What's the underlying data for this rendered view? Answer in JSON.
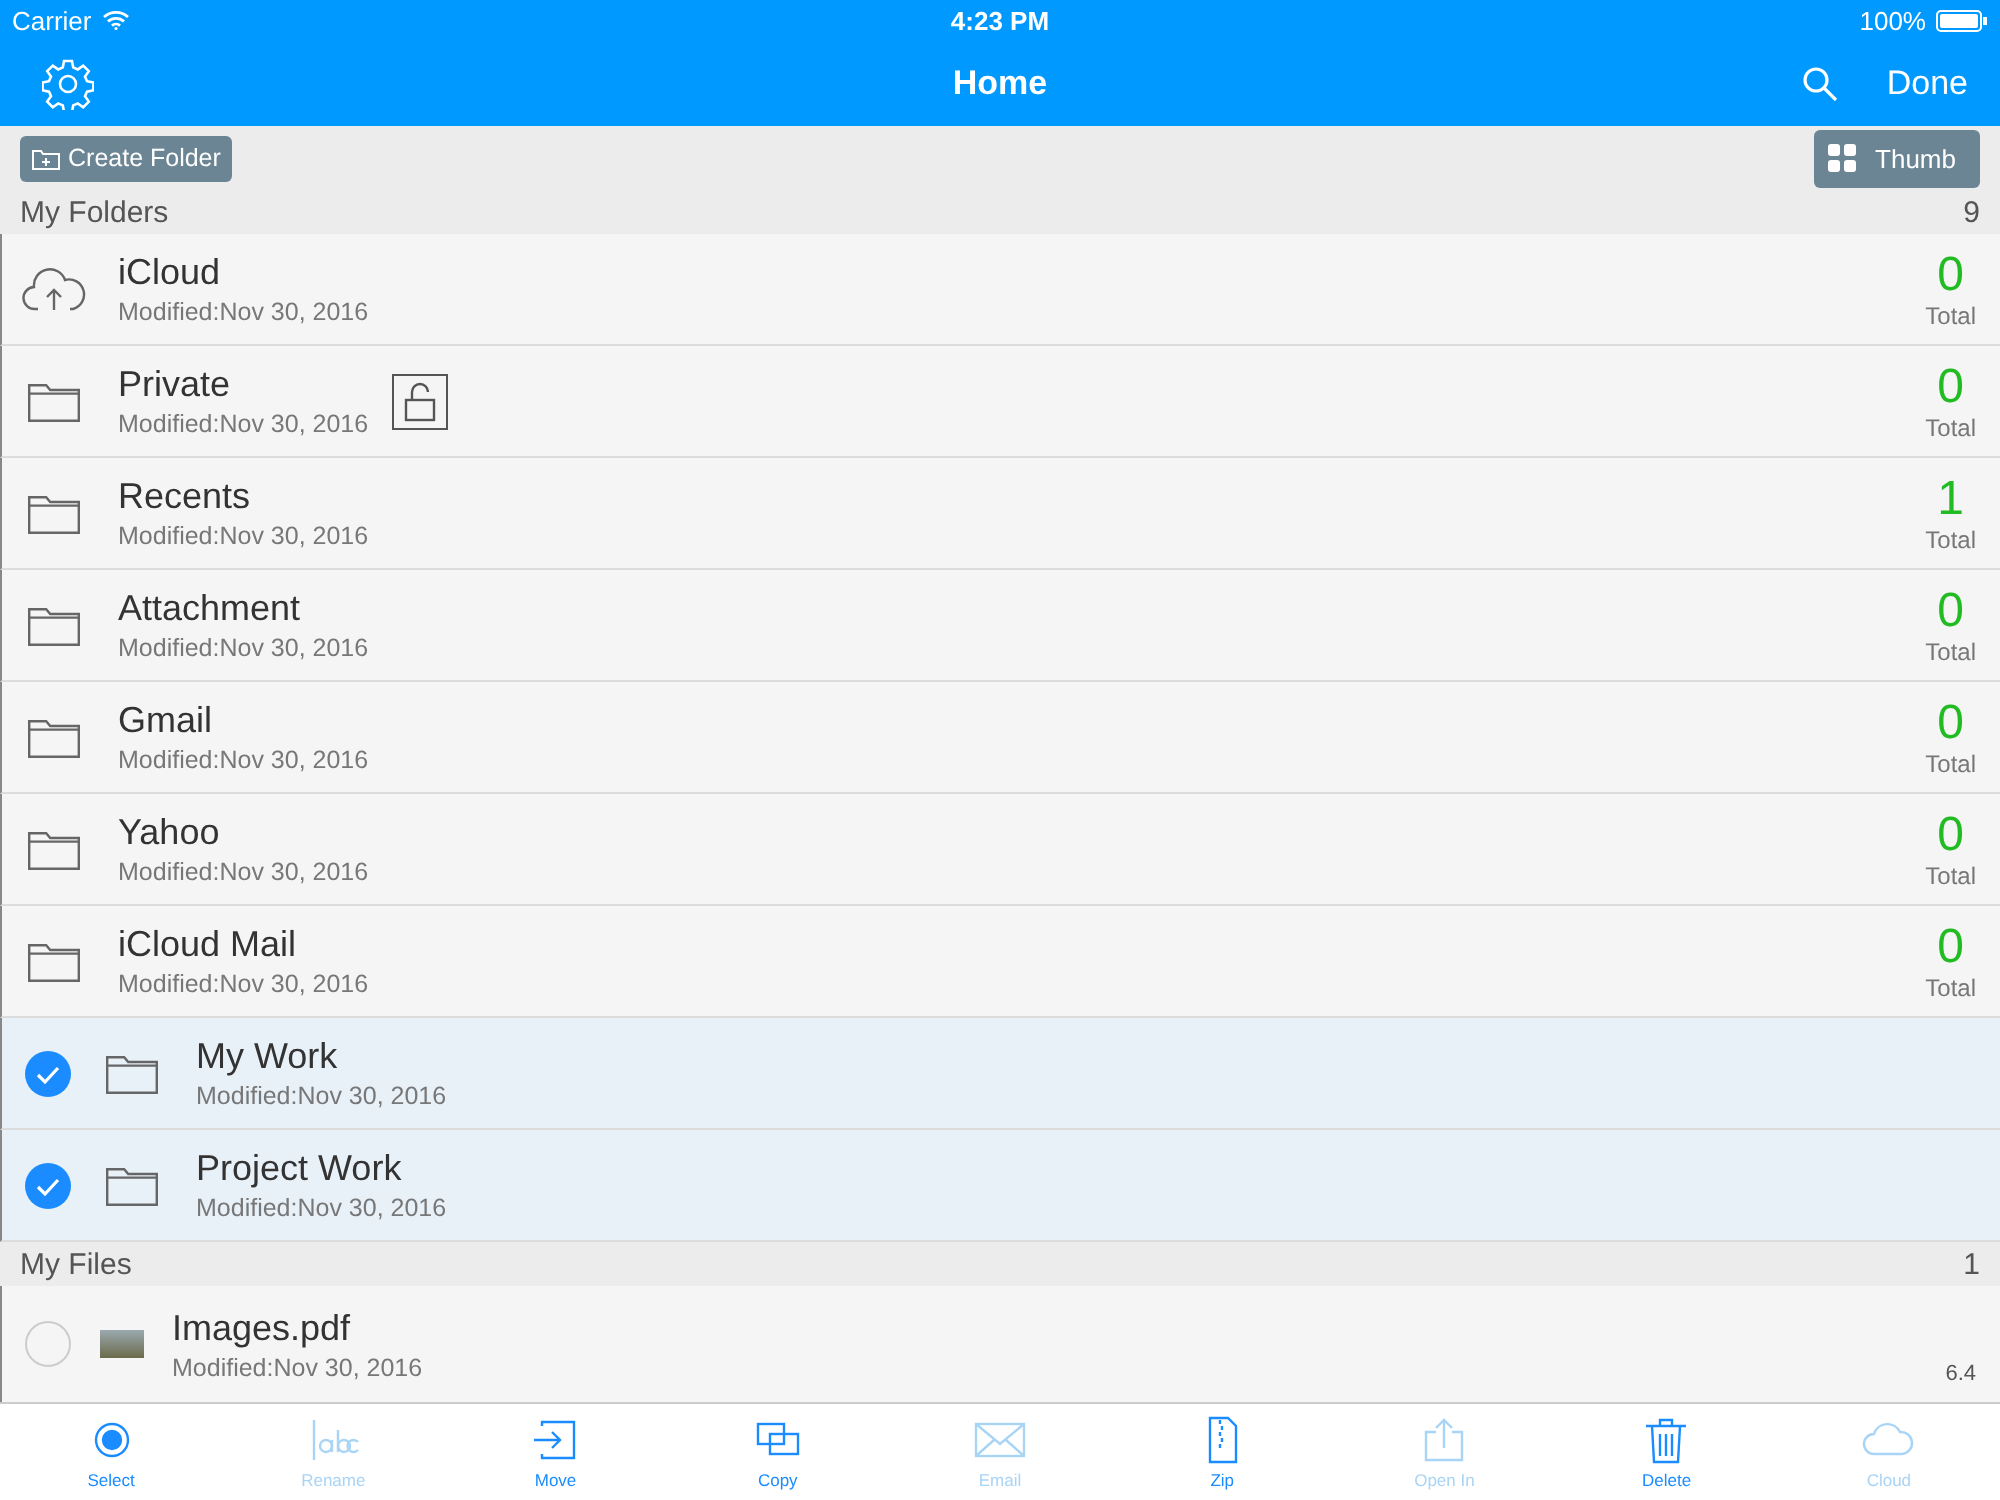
{
  "status_bar": {
    "carrier": "Carrier",
    "time": "4:23 PM",
    "battery": "100%"
  },
  "nav": {
    "title": "Home",
    "done": "Done"
  },
  "actions": {
    "create_folder": "Create Folder",
    "view": "Thumb"
  },
  "folders": {
    "title": "My Folders",
    "count": "9",
    "items": [
      {
        "kind": "cloud",
        "name": "iCloud",
        "modified": "Modified:Nov 30, 2016",
        "locked": false,
        "total": "0",
        "total_label": "Total"
      },
      {
        "kind": "folder",
        "name": "Private",
        "modified": "Modified:Nov 30, 2016",
        "locked": true,
        "total": "0",
        "total_label": "Total"
      },
      {
        "kind": "folder",
        "name": "Recents",
        "modified": "Modified:Nov 30, 2016",
        "locked": false,
        "total": "1",
        "total_label": "Total"
      },
      {
        "kind": "folder",
        "name": "Attachment",
        "modified": "Modified:Nov 30, 2016",
        "locked": false,
        "total": "0",
        "total_label": "Total"
      },
      {
        "kind": "folder",
        "name": "Gmail",
        "modified": "Modified:Nov 30, 2016",
        "locked": false,
        "total": "0",
        "total_label": "Total"
      },
      {
        "kind": "folder",
        "name": "Yahoo",
        "modified": "Modified:Nov 30, 2016",
        "locked": false,
        "total": "0",
        "total_label": "Total"
      },
      {
        "kind": "folder",
        "name": "iCloud Mail",
        "modified": "Modified:Nov 30, 2016",
        "locked": false,
        "total": "0",
        "total_label": "Total"
      },
      {
        "kind": "selectable",
        "name": "My Work",
        "modified": "Modified:Nov 30, 2016",
        "selected": true
      },
      {
        "kind": "selectable",
        "name": "Project Work",
        "modified": "Modified:Nov 30, 2016",
        "selected": true
      }
    ]
  },
  "files": {
    "title": "My Files",
    "count": "1",
    "items": [
      {
        "name": "Images.pdf",
        "modified": "Modified:Nov 30, 2016",
        "size": "6.4",
        "selected": false
      }
    ]
  },
  "toolbar": [
    {
      "kind": "select",
      "label": "Select",
      "disabled": false
    },
    {
      "kind": "rename",
      "label": "Rename",
      "disabled": true
    },
    {
      "kind": "move",
      "label": "Move",
      "disabled": false
    },
    {
      "kind": "copy",
      "label": "Copy",
      "disabled": false
    },
    {
      "kind": "email",
      "label": "Email",
      "disabled": true
    },
    {
      "kind": "zip",
      "label": "Zip",
      "disabled": false
    },
    {
      "kind": "openin",
      "label": "Open In",
      "disabled": true
    },
    {
      "kind": "delete",
      "label": "Delete",
      "disabled": false
    },
    {
      "kind": "cloud",
      "label": "Cloud",
      "disabled": true
    }
  ]
}
